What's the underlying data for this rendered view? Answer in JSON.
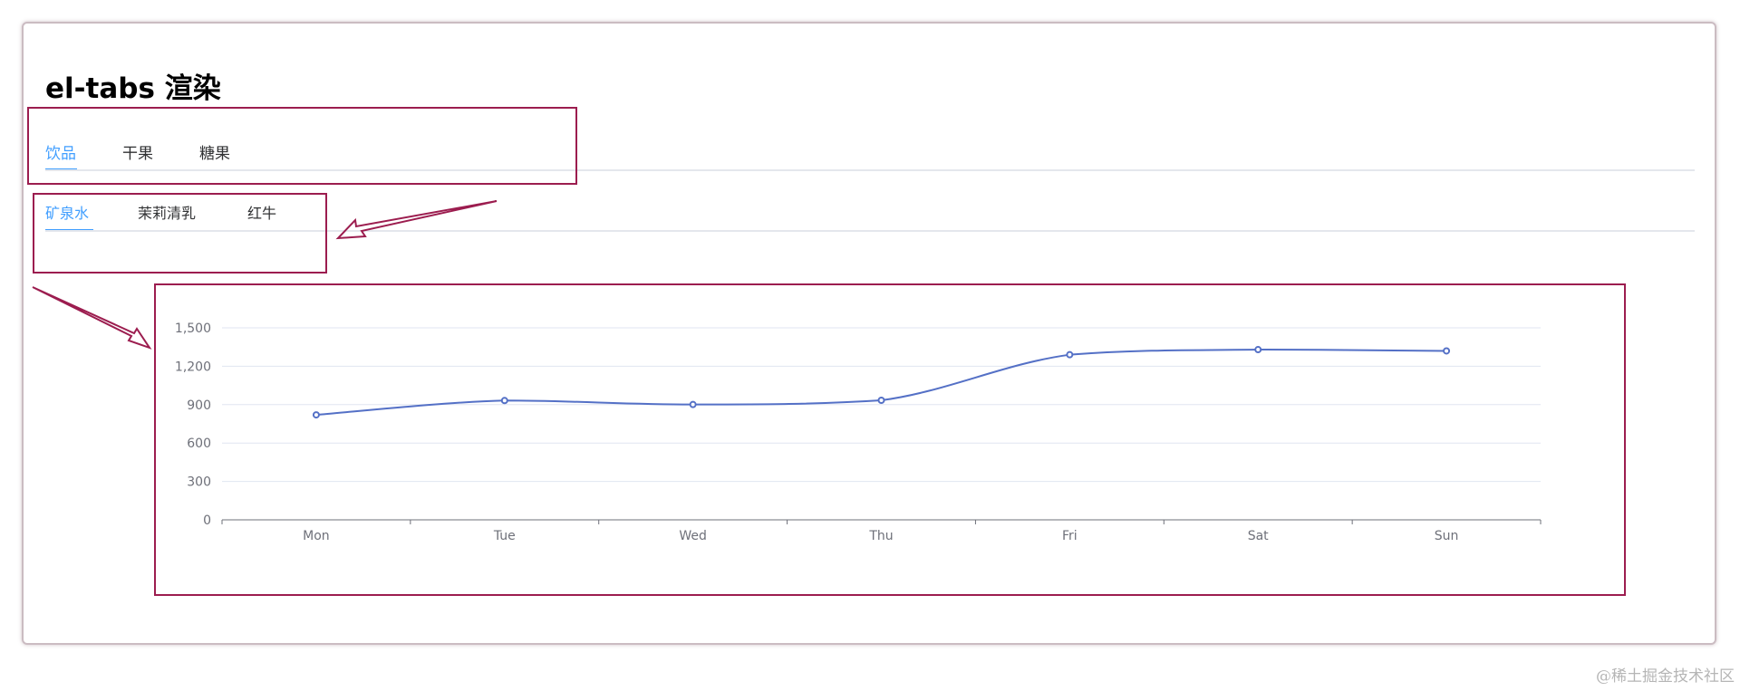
{
  "title": "el-tabs 渲染",
  "outer_tabs": {
    "items": [
      {
        "label": "饮品"
      },
      {
        "label": "干果"
      },
      {
        "label": "糖果"
      }
    ],
    "active": 0
  },
  "inner_tabs": {
    "items": [
      {
        "label": "矿泉水"
      },
      {
        "label": "茉莉清乳"
      },
      {
        "label": "红牛"
      }
    ],
    "active": 0
  },
  "watermark": "@稀土掘金技术社区",
  "colors": {
    "accent": "#409eff",
    "line": "#5470c6",
    "annotation": "#9c1d4f",
    "axis_text": "#6e7079",
    "grid": "#e0e6f1"
  },
  "chart_data": {
    "type": "line",
    "smooth": true,
    "categories": [
      "Mon",
      "Tue",
      "Wed",
      "Thu",
      "Fri",
      "Sat",
      "Sun"
    ],
    "series": [
      {
        "values": [
          820,
          932,
          901,
          934,
          1290,
          1330,
          1320
        ]
      }
    ],
    "ylim": [
      0,
      1500
    ],
    "yticks": [
      0,
      300,
      600,
      900,
      1200,
      1500
    ],
    "ytick_labels": [
      "0",
      "300",
      "600",
      "900",
      "1,200",
      "1,500"
    ],
    "grid": true,
    "show_points": true,
    "title": "",
    "xlabel": "",
    "ylabel": ""
  }
}
